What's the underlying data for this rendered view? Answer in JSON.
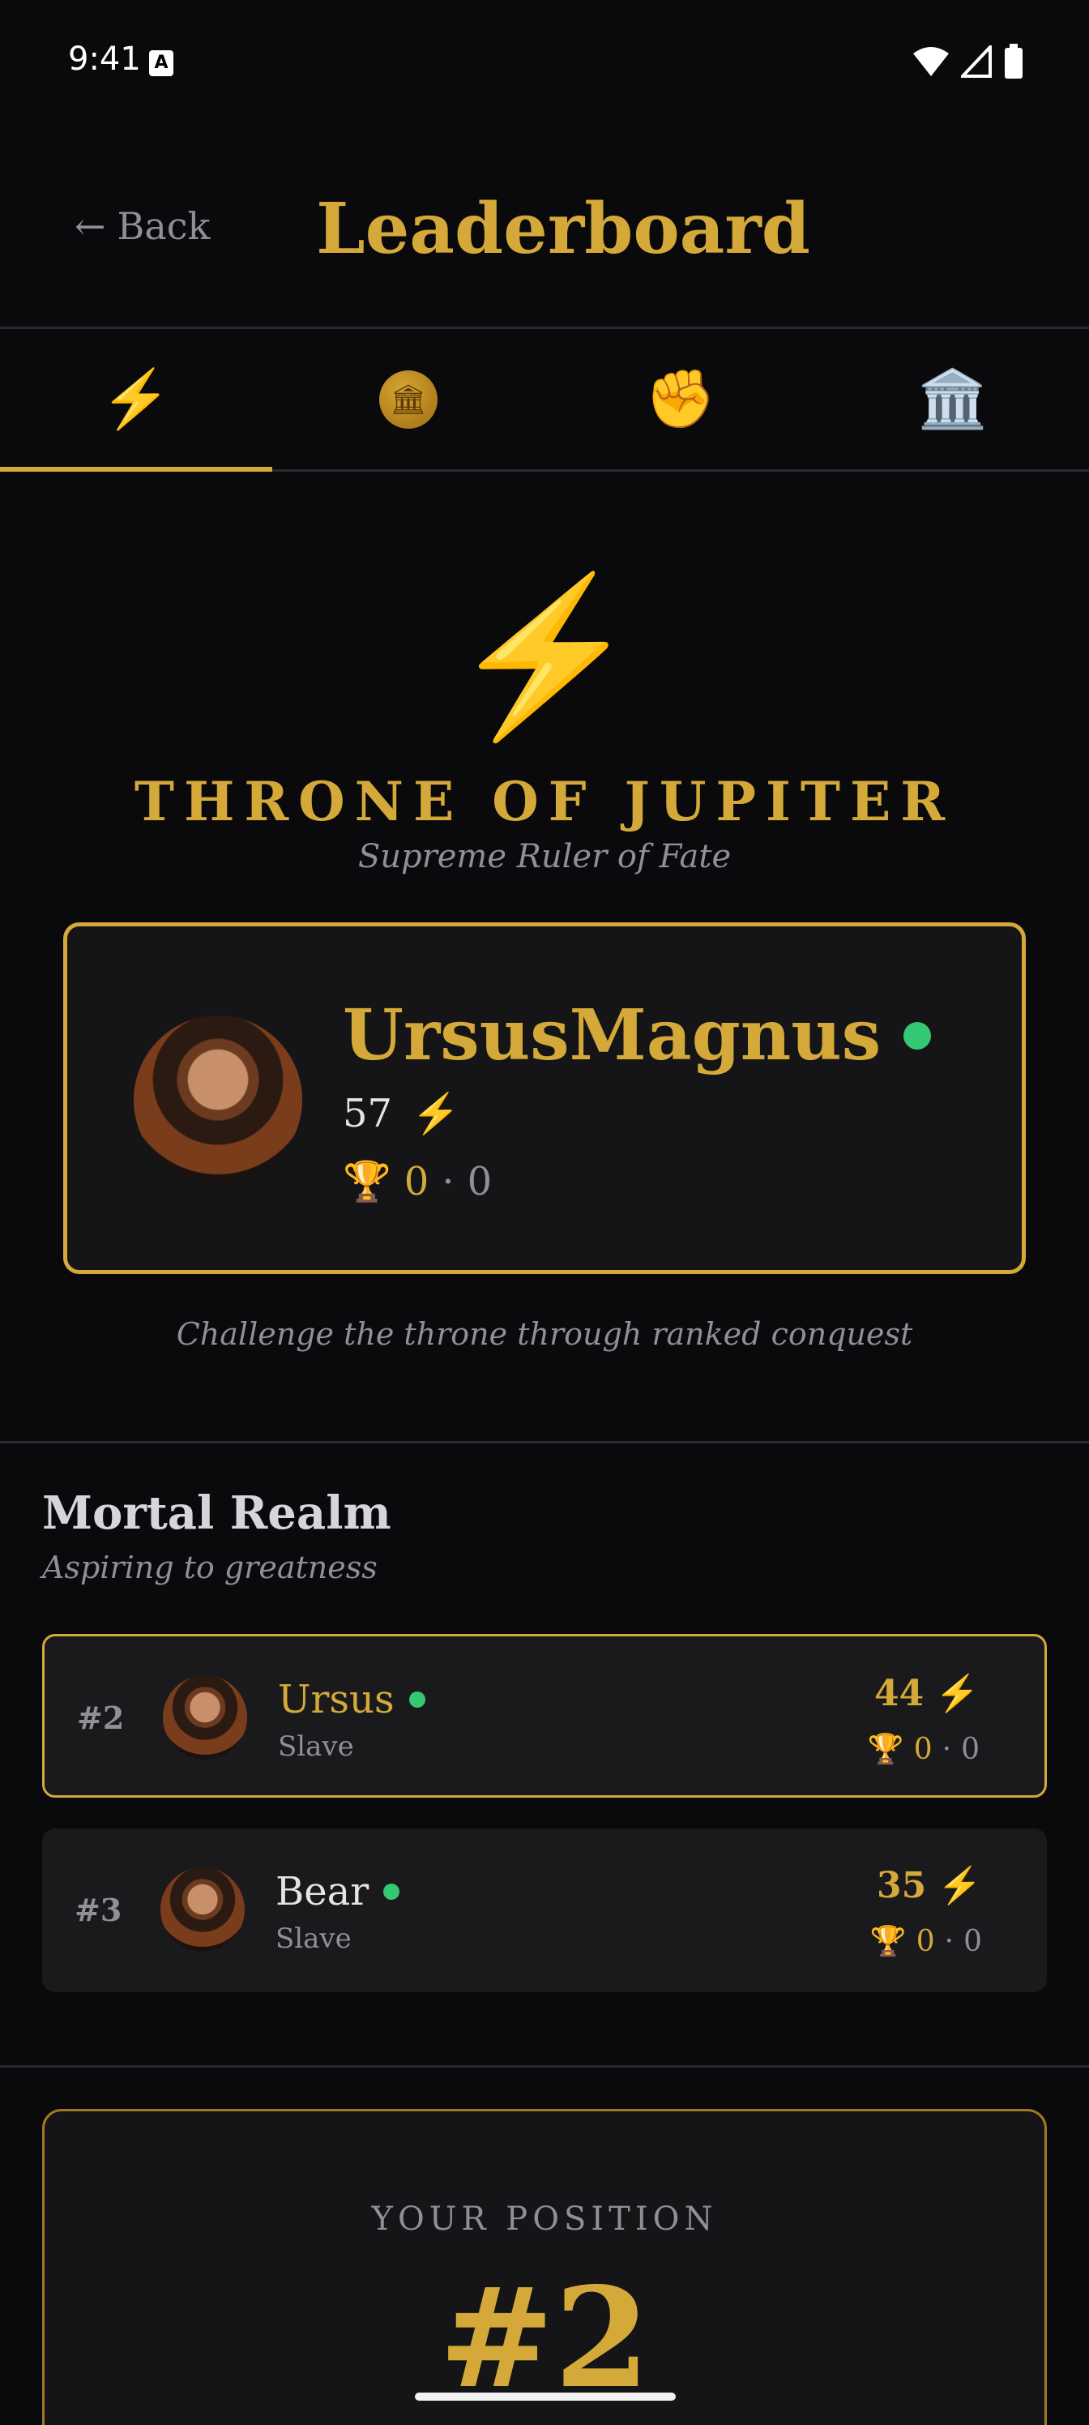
{
  "status_bar": {
    "time": "9:41",
    "a_icon": "A"
  },
  "header": {
    "back_arrow": "←",
    "back_label": "Back",
    "title": "Leaderboard"
  },
  "tabs": [
    {
      "icon": "⚡",
      "name": "lightning-icon",
      "active": true
    },
    {
      "icon": "🏛",
      "name": "coin-icon",
      "active": false
    },
    {
      "icon": "✊",
      "name": "fist-icon",
      "active": false
    },
    {
      "icon": "🏛️",
      "name": "temple-icon",
      "active": false
    }
  ],
  "throne": {
    "icon": "⚡",
    "title": "THRONE OF JUPITER",
    "subtitle": "Supreme Ruler of Fate",
    "player": {
      "name": "UrsusMagnus",
      "online": true,
      "score": "57",
      "score_icon": "⚡",
      "trophy_icon": "🏆",
      "wins": "0",
      "separator": "·",
      "losses": "0"
    },
    "challenge_text": "Challenge the throne through ranked conquest"
  },
  "mortal_realm": {
    "title": "Mortal Realm",
    "subtitle": "Aspiring to greatness",
    "entries": [
      {
        "rank": "#2",
        "name": "Ursus",
        "online": true,
        "title": "Slave",
        "score": "44",
        "score_icon": "⚡",
        "trophy_icon": "🏆",
        "wins": "0",
        "separator": "·",
        "losses": "0",
        "is_current_user": true
      },
      {
        "rank": "#3",
        "name": "Bear",
        "online": true,
        "title": "Slave",
        "score": "35",
        "score_icon": "⚡",
        "trophy_icon": "🏆",
        "wins": "0",
        "separator": "·",
        "losses": "0",
        "is_current_user": false
      }
    ]
  },
  "your_position": {
    "label": "YOUR POSITION",
    "value": "#2"
  },
  "colors": {
    "accent": "#d4a93a",
    "online": "#34c873",
    "background": "#0a0a0c",
    "card": "#1a1a1c"
  }
}
